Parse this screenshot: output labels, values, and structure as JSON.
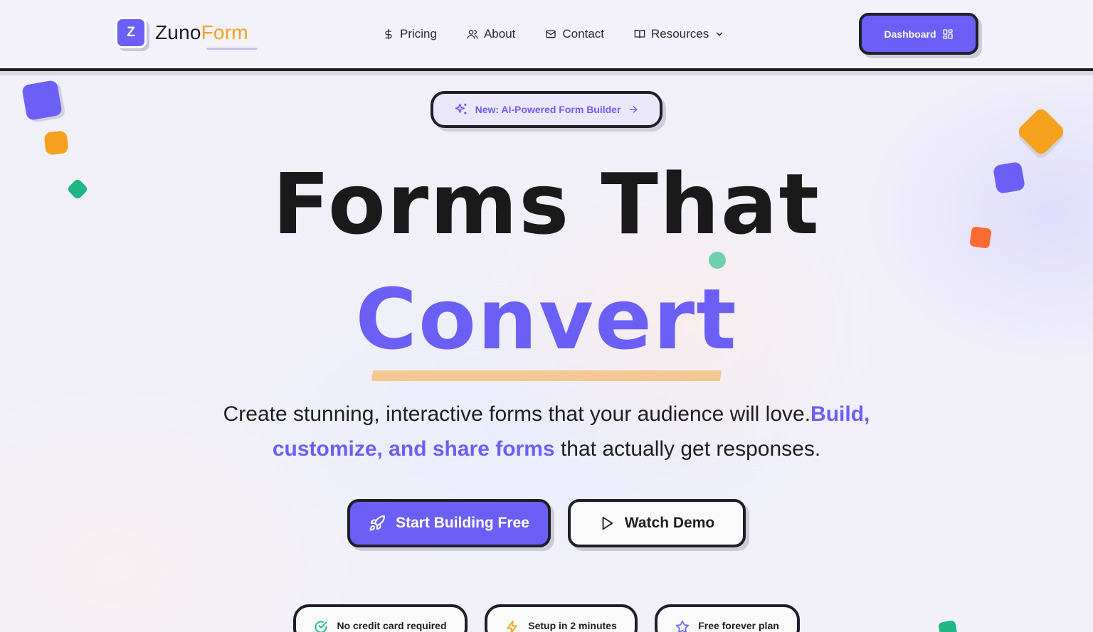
{
  "brand": {
    "logo_letter": "Z",
    "name_part1": "Zuno",
    "name_part2": "Form"
  },
  "nav": {
    "items": [
      {
        "label": "Pricing",
        "icon": "dollar-icon"
      },
      {
        "label": "About",
        "icon": "users-icon"
      },
      {
        "label": "Contact",
        "icon": "mail-icon"
      },
      {
        "label": "Resources",
        "icon": "book-icon"
      }
    ],
    "dashboard_label": "Dashboard"
  },
  "hero": {
    "badge": "New: AI-Powered Form Builder",
    "title_line1": "Forms That",
    "title_line2": "Convert",
    "subtitle_part1": "Create stunning, interactive forms that your audience will love.",
    "subtitle_highlight": "Build, customize, and share forms",
    "subtitle_part2": " that actually get responses.",
    "cta_primary": "Start Building Free",
    "cta_secondary": "Watch Demo"
  },
  "features": [
    {
      "label": "No credit card required",
      "icon": "check-circle-icon"
    },
    {
      "label": "Setup in 2 minutes",
      "icon": "lightning-icon"
    },
    {
      "label": "Free forever plan",
      "icon": "star-icon"
    }
  ],
  "colors": {
    "accent": "#6c5ff5",
    "orange": "#f5a11d",
    "green": "#1fb884",
    "red_orange": "#fb6b34",
    "dark": "#1f1f2b"
  }
}
